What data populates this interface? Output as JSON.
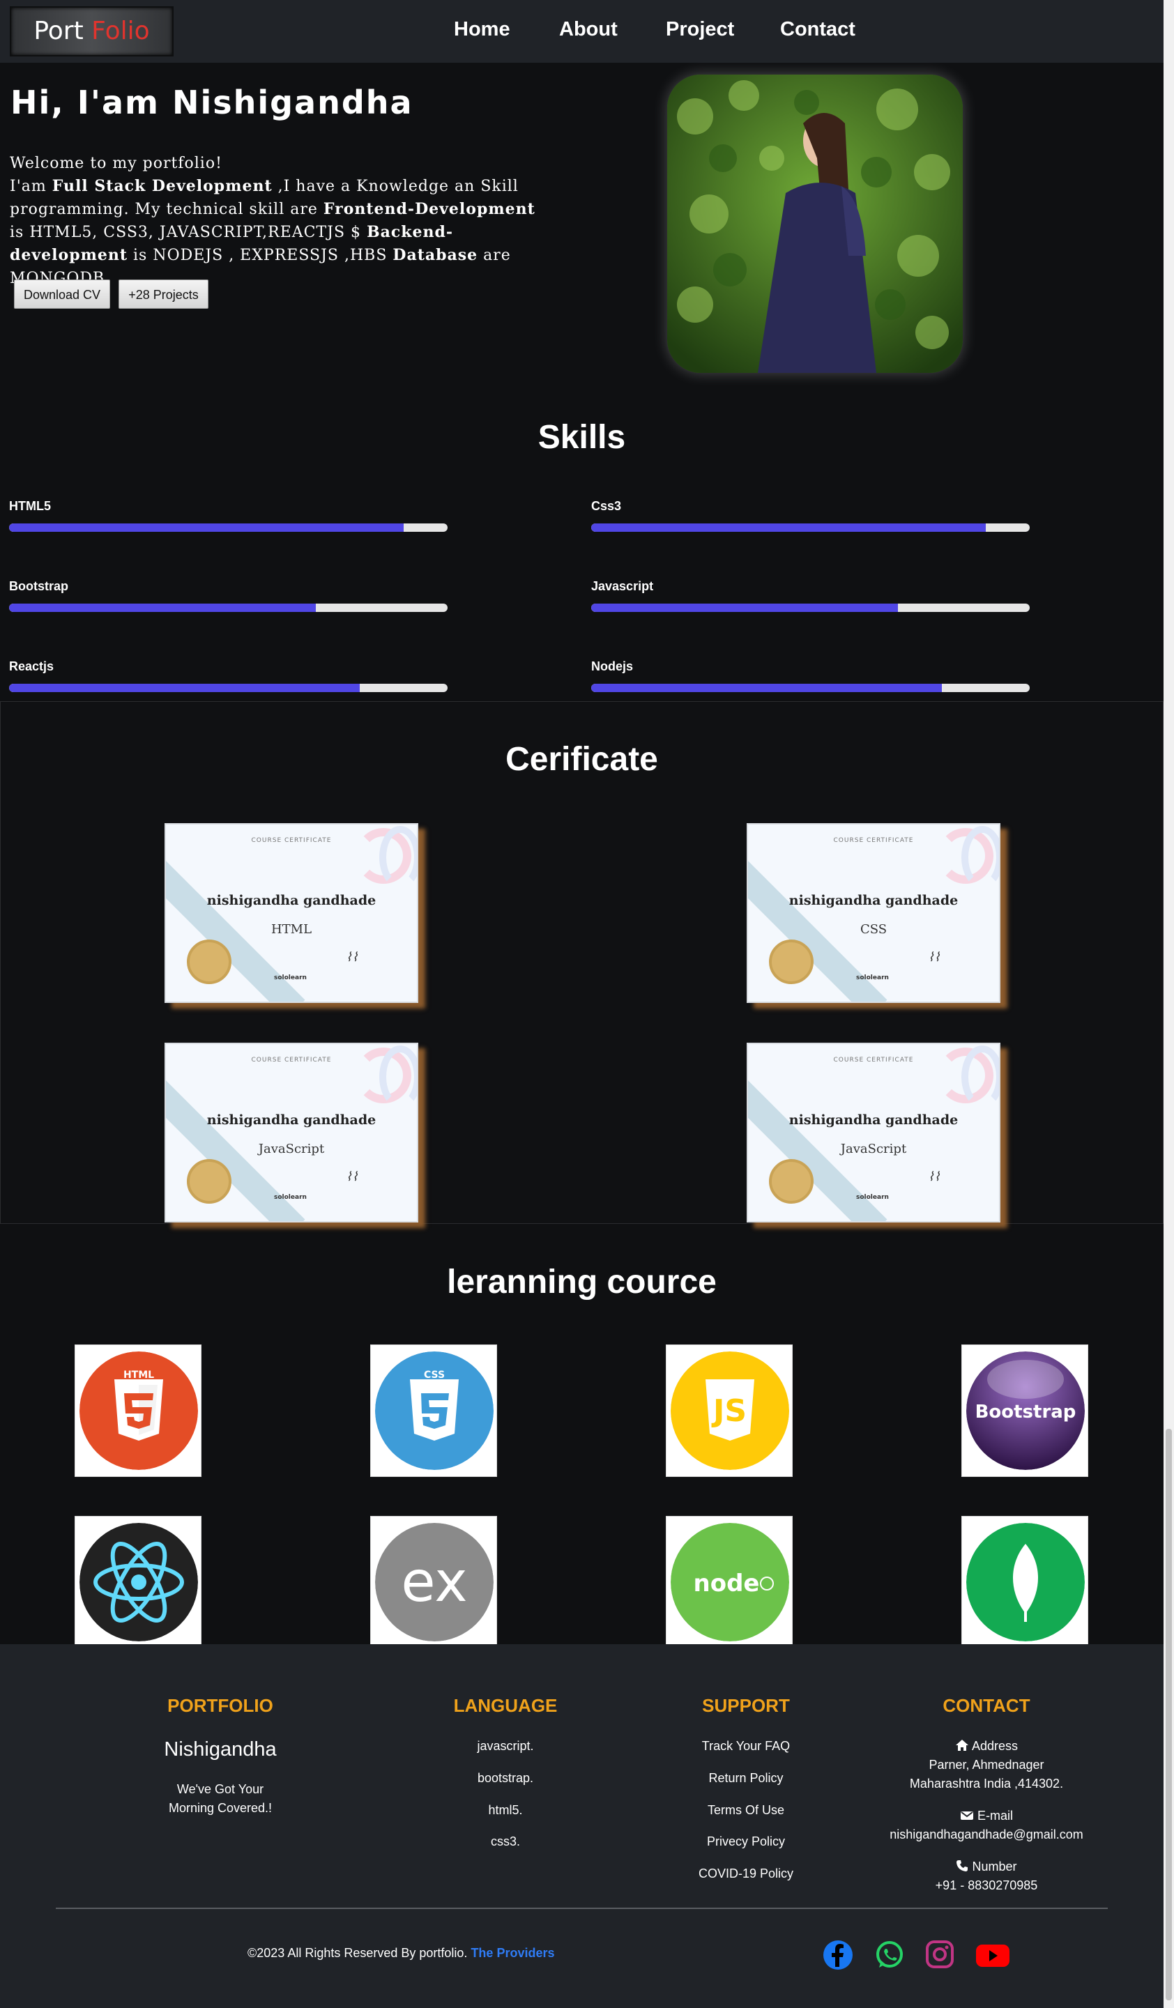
{
  "nav": {
    "logo_part1": "Port",
    "logo_part2": "Folio",
    "items": [
      "Home",
      "About",
      "Project",
      "Contact"
    ]
  },
  "hero": {
    "title": "Hi, I'am Nishigandha",
    "line1": "Welcome to my portfolio!",
    "p_intro": "I'am ",
    "p_role": "Full Stack Development",
    "p_mid1": " ,I have a Knowledge an Skill programming. My technical skill are ",
    "p_frontend": "Frontend-Development",
    "p_mid2": " is HTML5, CSS3, JAVASCRIPT,REACTJS $ ",
    "p_backend": "Backend-development",
    "p_mid3": " is NODEJS , EXPRESSJS ,HBS ",
    "p_database": "Database",
    "p_end": " are MONGODB.",
    "btn_cv": "Download CV",
    "btn_projects": "+28 Projects"
  },
  "skills": {
    "title": "Skills",
    "items": [
      {
        "label": "HTML5",
        "level": 0.9
      },
      {
        "label": "Css3",
        "level": 0.9
      },
      {
        "label": "Bootstrap",
        "level": 0.7
      },
      {
        "label": "Javascript",
        "level": 0.7
      },
      {
        "label": "Reactjs",
        "level": 0.8
      },
      {
        "label": "Nodejs",
        "level": 0.8
      }
    ]
  },
  "certificates": {
    "title": "Cerificate",
    "items": [
      {
        "heading": "COURSE CERTIFICATE",
        "name": "nishigandha gandhade",
        "course": "HTML",
        "brand": "sololearn"
      },
      {
        "heading": "COURSE CERTIFICATE",
        "name": "nishigandha gandhade",
        "course": "CSS",
        "brand": "sololearn"
      },
      {
        "heading": "COURSE CERTIFICATE",
        "name": "nishigandha gandhade",
        "course": "JavaScript",
        "brand": "sololearn"
      },
      {
        "heading": "COURSE CERTIFICATE",
        "name": "nishigandha gandhade",
        "course": "JavaScript",
        "brand": "sololearn"
      }
    ]
  },
  "learning": {
    "title": "leranning cource",
    "items": [
      {
        "icon": "html5-icon",
        "text": "HTML",
        "color": "#e44d26"
      },
      {
        "icon": "css3-icon",
        "text": "CSS",
        "color": "#3e9cd8"
      },
      {
        "icon": "javascript-icon",
        "text": "JS",
        "color": "#ffca08"
      },
      {
        "icon": "bootstrap-icon",
        "text": "Bootstrap",
        "color": "#563d7c"
      },
      {
        "icon": "react-icon",
        "text": "",
        "color": "#222222"
      },
      {
        "icon": "express-icon",
        "text": "ex",
        "color": "#8a8a8a"
      },
      {
        "icon": "nodejs-icon",
        "text": "node",
        "color": "#6cc24a"
      },
      {
        "icon": "mongodb-icon",
        "text": "",
        "color": "#13aa52"
      }
    ]
  },
  "footer": {
    "portfolio": {
      "heading": "PORTFOLIO",
      "name": "Nishigandha",
      "tag1": "We've Got Your",
      "tag2": "Morning Covered.!"
    },
    "language": {
      "heading": "LANGUAGE",
      "items": [
        "javascript.",
        "bootstrap.",
        "html5.",
        "css3."
      ]
    },
    "support": {
      "heading": "SUPPORT",
      "items": [
        "Track Your FAQ",
        "Return Policy",
        "Terms Of Use",
        "Privecy Policy",
        "COVID-19 Policy"
      ]
    },
    "contact": {
      "heading": "CONTACT",
      "address_label": "Address",
      "address1": "Parner, Ahmednager",
      "address2": "Maharashtra India ,414302.",
      "email_label": "E-mail",
      "email": "nishigandhagandhade@gmail.com",
      "number_label": "Number",
      "number": "+91 - 8830270985"
    },
    "copyright": "©2023 All Rights Reserved By portfolio.",
    "providers": "The Providers",
    "social": [
      {
        "name": "facebook-icon",
        "color": "#1877f2"
      },
      {
        "name": "whatsapp-icon",
        "color": "#25d366"
      },
      {
        "name": "instagram-icon",
        "color": "#c13584"
      },
      {
        "name": "youtube-icon",
        "color": "#ff0000"
      }
    ]
  },
  "colors": {
    "accent_bar": "#5046e5",
    "footer_heading": "#f0a21b",
    "logo_red": "#e0342e"
  }
}
